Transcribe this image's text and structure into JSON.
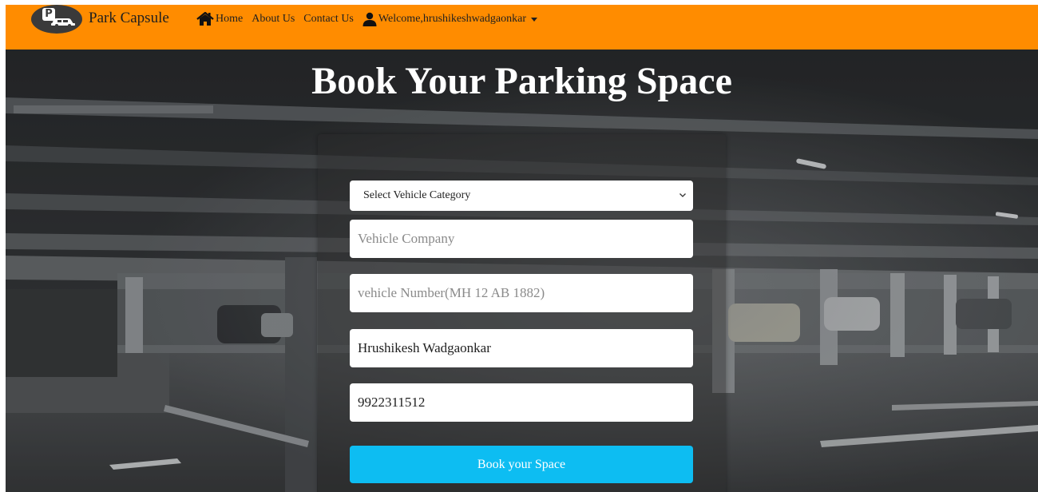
{
  "brand": {
    "name": "Park Capsule",
    "logo_letter": "P"
  },
  "nav": {
    "home": "Home",
    "about": "About Us",
    "contact": "Contact Us",
    "welcome": "Welcome,hrushikeshwadgaonkar"
  },
  "page": {
    "title": "Book Your Parking Space"
  },
  "form": {
    "category_selected": "Select Vehicle Category",
    "company_placeholder": "Vehicle Company",
    "company_value": "",
    "number_placeholder": "vehicle Number(MH 12 AB 1882)",
    "number_value": "",
    "owner_name_value": "Hrushikesh Wadgaonkar",
    "phone_value": "9922311512",
    "submit_label": "Book your Space"
  },
  "colors": {
    "navbar": "#ff8c00",
    "button": "#0dbdf2",
    "title": "#ffffff"
  },
  "icons": {
    "logo": "parking-car-logo",
    "home": "home-icon",
    "user": "user-icon",
    "dropdown": "caret-down-icon",
    "select": "chevron-down-icon"
  }
}
